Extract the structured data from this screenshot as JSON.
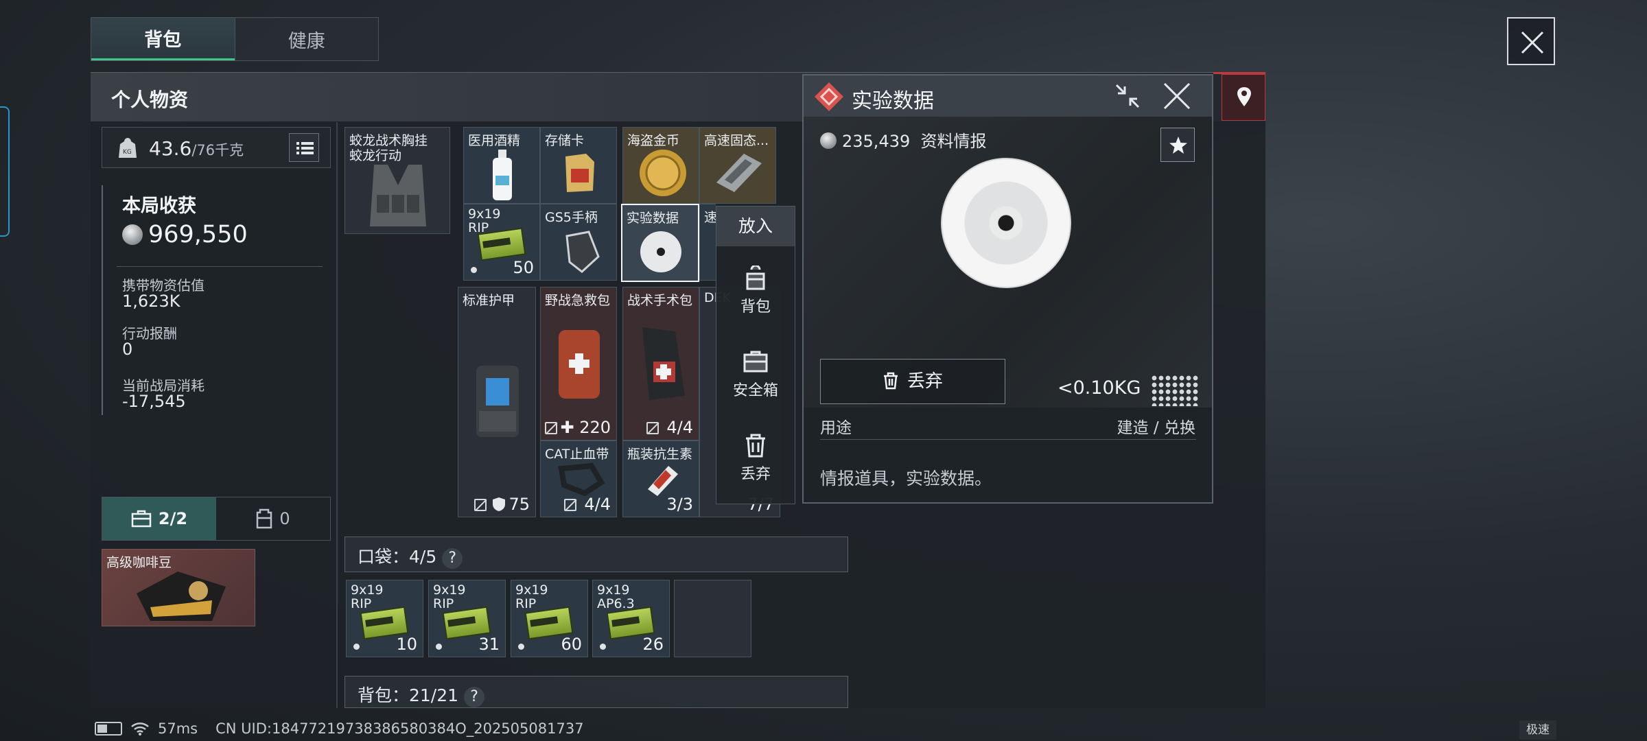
{
  "tabs": [
    {
      "label": "背包"
    },
    {
      "label": "健康"
    }
  ],
  "panel": {
    "title": "个人物资"
  },
  "weight": {
    "current": "43.6",
    "max": "/76千克"
  },
  "haul": {
    "title": "本局收获",
    "total": "969,550",
    "stats": [
      {
        "label": "携带物资估值",
        "value": "1,623K"
      },
      {
        "label": "行动报酬",
        "value": "0"
      },
      {
        "label": "当前战局消耗",
        "value": "-17,545"
      }
    ]
  },
  "case_tabs": [
    {
      "label": "2/2"
    },
    {
      "label": "0"
    }
  ],
  "coffee": {
    "name": "高级咖啡豆"
  },
  "gear": {
    "vest_name": "蛟龙战术胸挂",
    "vest_sub": "蛟龙行动"
  },
  "items": {
    "alcohol": "医用酒精",
    "sd_card": "存储卡",
    "pirate_coin": "海盗金币",
    "ssd": "高速固态...",
    "ammo_rip": {
      "name": "9x19\nRIP",
      "count": "50"
    },
    "gs5": "GS5手柄",
    "exp_data": "实验数据",
    "partial": "速",
    "armor": {
      "name": "标准护甲",
      "durability": "75"
    },
    "field_kit": {
      "name": "野战急救包",
      "count": "220"
    },
    "surgery_kit": {
      "name": "战术手术包",
      "count": "4/4"
    },
    "deck": {
      "name": "DEK",
      "count": "7/7"
    },
    "tourniquet": {
      "name": "CAT止血带",
      "count": "4/4"
    },
    "antibiotic": {
      "name": "瓶装抗生素",
      "count": "3/3"
    }
  },
  "pocket": {
    "label": "口袋：4/5",
    "help": "?",
    "slots": [
      {
        "name": "9x19\nRIP",
        "count": "10"
      },
      {
        "name": "9x19\nRIP",
        "count": "31"
      },
      {
        "name": "9x19\nRIP",
        "count": "60"
      },
      {
        "name": "9x19\nAP6.3",
        "count": "26"
      }
    ]
  },
  "backpack": {
    "label": "背包：21/21",
    "help": "?"
  },
  "context_menu": {
    "header": "放入",
    "items": [
      {
        "label": "背包"
      },
      {
        "label": "安全箱"
      },
      {
        "label": "丢弃"
      }
    ]
  },
  "detail": {
    "title": "实验数据",
    "value": "235,439",
    "category": "资料情报",
    "weight": "<0.10KG",
    "discard": "丢弃",
    "use_label": "用途",
    "craft_label": "建造 / 兑换",
    "description": "情报道具，实验数据。"
  },
  "footer": {
    "ping": "57ms",
    "uid": "CN UID:18477219738386580384O_202505081737",
    "speed": "极速"
  },
  "colors": {
    "accent_green": "#42c28c",
    "accent_red": "#c0393c",
    "case_teal": "#2f5a58"
  }
}
